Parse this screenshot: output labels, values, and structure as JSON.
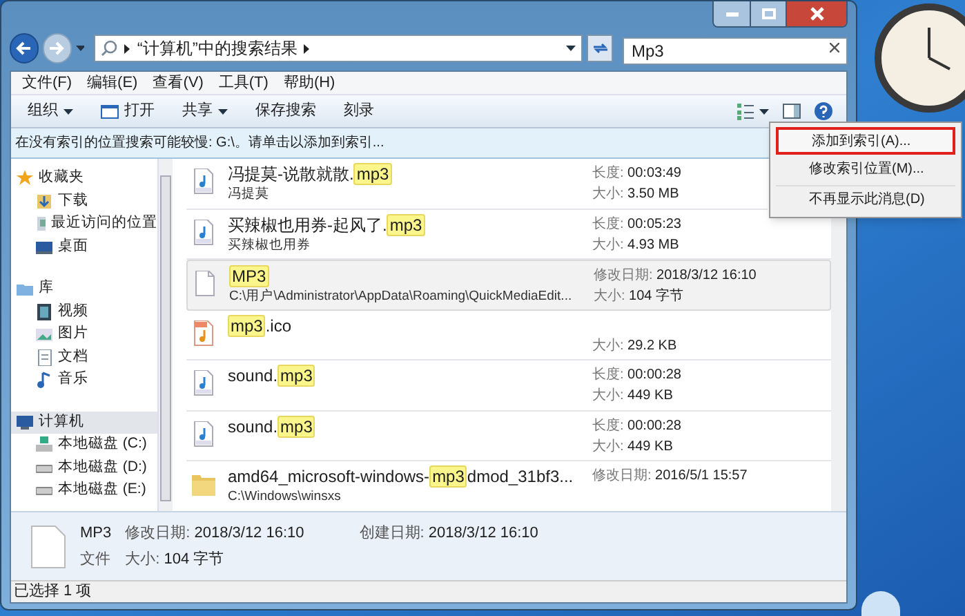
{
  "address_bar": {
    "path": "“计算机”中的搜索结果"
  },
  "search": {
    "value": "Mp3"
  },
  "menu": [
    "文件(F)",
    "编辑(E)",
    "查看(V)",
    "工具(T)",
    "帮助(H)"
  ],
  "toolbar": [
    {
      "label": "组织",
      "dropdown": true
    },
    {
      "label": "打开",
      "dropdown": false
    },
    {
      "label": "共享",
      "dropdown": true
    },
    {
      "label": "保存搜索",
      "dropdown": false
    },
    {
      "label": "刻录",
      "dropdown": false
    }
  ],
  "info_bar": "在没有索引的位置搜索可能较慢: G:\\。请单击以添加到索引...",
  "nav": [
    {
      "label": "收藏夹",
      "selected": false,
      "children": [
        {
          "label": "下载"
        },
        {
          "label": "最近访问的位置"
        },
        {
          "label": "桌面"
        }
      ]
    },
    {
      "label": "库",
      "selected": false,
      "children": [
        {
          "label": "视频"
        },
        {
          "label": "图片"
        },
        {
          "label": "文档"
        },
        {
          "label": "音乐"
        }
      ]
    },
    {
      "label": "计算机",
      "selected": true,
      "children": [
        {
          "label": "本地磁盘 (C:)"
        },
        {
          "label": "本地磁盘 (D:)"
        },
        {
          "label": "本地磁盘 (E:)"
        }
      ]
    }
  ],
  "results": [
    {
      "kind": "audio",
      "selected": false,
      "name": [
        {
          "text": "冯提莫-说散就散.",
          "highlight": false
        },
        {
          "text": "mp3",
          "highlight": true
        }
      ],
      "subtitle": "冯提莫",
      "details": [
        {
          "label": "长度:",
          "value": "00:03:49"
        },
        {
          "label": "大小:",
          "value": "3.50 MB"
        }
      ]
    },
    {
      "kind": "audio",
      "selected": false,
      "name": [
        {
          "text": "买辣椒也用券-起风了.",
          "highlight": false
        },
        {
          "text": "mp3",
          "highlight": true
        }
      ],
      "subtitle": "买辣椒也用券",
      "details": [
        {
          "label": "长度:",
          "value": "00:05:23"
        },
        {
          "label": "大小:",
          "value": "4.93 MB"
        }
      ]
    },
    {
      "kind": "file",
      "selected": true,
      "name": [
        {
          "text": "MP3",
          "highlight": true
        }
      ],
      "subtitle": "C:\\用户\\Administrator\\AppData\\Roaming\\QuickMediaEdit...",
      "details": [
        {
          "label": "修改日期:",
          "value": "2018/3/12 16:10"
        },
        {
          "label": "大小:",
          "value": "104 字节"
        }
      ]
    },
    {
      "kind": "image",
      "selected": false,
      "name": [
        {
          "text": "mp3",
          "highlight": true
        },
        {
          "text": ".ico",
          "highlight": false
        }
      ],
      "details": [
        {
          "label": "大小:",
          "value": "29.2 KB"
        }
      ]
    },
    {
      "kind": "audio",
      "selected": false,
      "name": [
        {
          "text": "sound.",
          "highlight": false
        },
        {
          "text": "mp3",
          "highlight": true
        }
      ],
      "details": [
        {
          "label": "长度:",
          "value": "00:00:28"
        },
        {
          "label": "大小:",
          "value": "449 KB"
        }
      ]
    },
    {
      "kind": "audio",
      "selected": false,
      "name": [
        {
          "text": "sound.",
          "highlight": false
        },
        {
          "text": "mp3",
          "highlight": true
        }
      ],
      "details": [
        {
          "label": "长度:",
          "value": "00:00:28"
        },
        {
          "label": "大小:",
          "value": "449 KB"
        }
      ]
    },
    {
      "kind": "folder",
      "selected": false,
      "name": [
        {
          "text": "amd64_microsoft-windows-",
          "highlight": false
        },
        {
          "text": "mp3",
          "highlight": true
        },
        {
          "text": "dmod_31bf3...",
          "highlight": false
        }
      ],
      "subtitle": "C:\\Windows\\winsxs",
      "details": [
        {
          "label": "修改日期:",
          "value": "2016/5/1 15:57"
        }
      ]
    }
  ],
  "details_pane": {
    "name": "MP3",
    "type": "文件",
    "fields": [
      {
        "label": "修改日期:",
        "value": "2018/3/12 16:10"
      },
      {
        "label": "创建日期:",
        "value": "2018/3/12 16:10"
      },
      {
        "label": "大小:",
        "value": "104 字节"
      }
    ]
  },
  "status_bar": "已选择 1 项",
  "context_menu": [
    {
      "label": "添加到索引(A)...",
      "highlighted": true
    },
    {
      "label": "修改索引位置(M)...",
      "highlighted": false
    },
    {
      "label": "不再显示此消息(D)",
      "highlighted": false
    }
  ]
}
